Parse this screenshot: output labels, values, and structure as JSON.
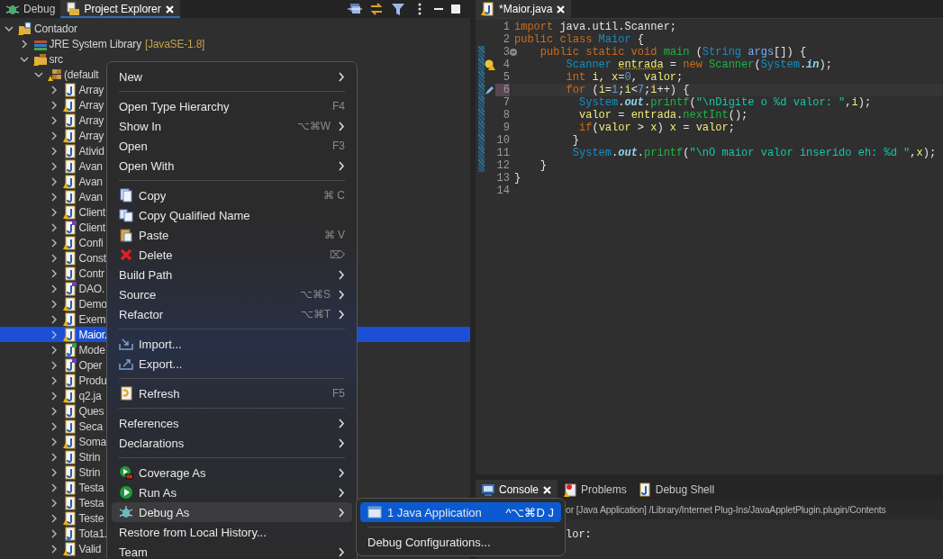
{
  "explorer": {
    "tabs": [
      {
        "label": "Debug",
        "kind": "debug",
        "selected": false,
        "closable": false
      },
      {
        "label": "Project Explorer",
        "kind": "explorer",
        "selected": true,
        "closable": true
      }
    ],
    "tree": [
      {
        "label": "Contador",
        "kind": "project",
        "expanded": true,
        "selected": false,
        "children": [
          {
            "label": "JRE System Library",
            "qualifier": "[JavaSE-1.8]",
            "kind": "library",
            "expanded": false,
            "selected": false
          },
          {
            "label": "src",
            "kind": "source-folder",
            "expanded": true,
            "selected": false,
            "children": [
              {
                "label": "(default",
                "kind": "package",
                "expanded": true,
                "selected": false,
                "children": [
                  {
                    "label": "Array",
                    "kind": "java",
                    "warning": false,
                    "expanded": false,
                    "selected": false
                  },
                  {
                    "label": "Array",
                    "kind": "java",
                    "warning": true,
                    "expanded": false,
                    "selected": false
                  },
                  {
                    "label": "Array",
                    "kind": "java",
                    "warning": false,
                    "expanded": false,
                    "selected": false
                  },
                  {
                    "label": "Array",
                    "kind": "java",
                    "warning": true,
                    "expanded": false,
                    "selected": false
                  },
                  {
                    "label": "Ativid",
                    "kind": "java",
                    "warning": false,
                    "expanded": false,
                    "selected": false
                  },
                  {
                    "label": "Avan",
                    "kind": "java",
                    "warning": false,
                    "expanded": false,
                    "selected": false
                  },
                  {
                    "label": "Avan",
                    "kind": "java",
                    "warning": true,
                    "expanded": false,
                    "selected": false
                  },
                  {
                    "label": "Avan",
                    "kind": "java",
                    "warning": false,
                    "expanded": false,
                    "selected": false
                  },
                  {
                    "label": "Client",
                    "kind": "java",
                    "warning": true,
                    "expanded": false,
                    "selected": false
                  },
                  {
                    "label": "Client",
                    "kind": "java-interface",
                    "warning": false,
                    "expanded": false,
                    "selected": false
                  },
                  {
                    "label": "Confi",
                    "kind": "java",
                    "warning": true,
                    "expanded": false,
                    "selected": false
                  },
                  {
                    "label": "Const",
                    "kind": "java",
                    "warning": false,
                    "expanded": false,
                    "selected": false
                  },
                  {
                    "label": "Contr",
                    "kind": "java",
                    "warning": false,
                    "expanded": false,
                    "selected": false
                  },
                  {
                    "label": "DAO.",
                    "kind": "java-interface",
                    "warning": false,
                    "expanded": false,
                    "selected": false
                  },
                  {
                    "label": "Demo",
                    "kind": "java",
                    "warning": true,
                    "expanded": false,
                    "selected": false
                  },
                  {
                    "label": "Exem",
                    "kind": "java",
                    "warning": true,
                    "expanded": false,
                    "selected": false
                  },
                  {
                    "label": "Maior.",
                    "kind": "java",
                    "warning": true,
                    "expanded": false,
                    "selected": true
                  },
                  {
                    "label": "Mode",
                    "kind": "java-abstract",
                    "warning": false,
                    "expanded": false,
                    "selected": false
                  },
                  {
                    "label": "Oper",
                    "kind": "java-interface",
                    "warning": false,
                    "expanded": false,
                    "selected": false
                  },
                  {
                    "label": "Produ",
                    "kind": "java",
                    "warning": false,
                    "expanded": false,
                    "selected": false
                  },
                  {
                    "label": "q2.ja",
                    "kind": "java",
                    "warning": true,
                    "expanded": false,
                    "selected": false
                  },
                  {
                    "label": "Ques",
                    "kind": "java",
                    "warning": false,
                    "expanded": false,
                    "selected": false
                  },
                  {
                    "label": "Seca",
                    "kind": "java",
                    "warning": false,
                    "expanded": false,
                    "selected": false
                  },
                  {
                    "label": "Soma",
                    "kind": "java",
                    "warning": true,
                    "expanded": false,
                    "selected": false
                  },
                  {
                    "label": "Strin",
                    "kind": "java",
                    "warning": false,
                    "expanded": false,
                    "selected": false
                  },
                  {
                    "label": "Strin",
                    "kind": "java",
                    "warning": false,
                    "expanded": false,
                    "selected": false
                  },
                  {
                    "label": "Testa",
                    "kind": "java",
                    "warning": false,
                    "expanded": false,
                    "selected": false
                  },
                  {
                    "label": "Testa",
                    "kind": "java",
                    "warning": false,
                    "expanded": false,
                    "selected": false
                  },
                  {
                    "label": "Teste",
                    "kind": "java",
                    "warning": true,
                    "expanded": false,
                    "selected": false
                  },
                  {
                    "label": "Tota1.",
                    "kind": "java-shared",
                    "warning": false,
                    "expanded": false,
                    "selected": false
                  },
                  {
                    "label": "Valid",
                    "kind": "java",
                    "warning": true,
                    "expanded": false,
                    "selected": false
                  }
                ]
              }
            ]
          }
        ]
      }
    ]
  },
  "context_menu": {
    "items": [
      {
        "kind": "plain",
        "label": "New",
        "submenu": true,
        "selected": false
      },
      {
        "kind": "separator"
      },
      {
        "kind": "plain",
        "label": "Open Type Hierarchy",
        "shortcut": "F4",
        "submenu": false,
        "selected": false
      },
      {
        "kind": "plain",
        "label": "Show In",
        "shortcut": "⌥⌘W",
        "submenu": true,
        "selected": false
      },
      {
        "kind": "plain",
        "label": "Open",
        "shortcut": "F3",
        "submenu": false,
        "selected": false
      },
      {
        "kind": "plain",
        "label": "Open With",
        "submenu": true,
        "selected": false
      },
      {
        "kind": "separator"
      },
      {
        "kind": "copy",
        "label": "Copy",
        "shortcut": "⌘ C",
        "submenu": false,
        "selected": false
      },
      {
        "kind": "copy-qualified",
        "label": "Copy Qualified Name",
        "submenu": false,
        "selected": false
      },
      {
        "kind": "paste",
        "label": "Paste",
        "shortcut": "⌘ V",
        "submenu": false,
        "selected": false
      },
      {
        "kind": "delete",
        "label": "Delete",
        "shortcut": "⌦",
        "submenu": false,
        "selected": false
      },
      {
        "kind": "plain",
        "label": "Build Path",
        "submenu": true,
        "selected": false
      },
      {
        "kind": "plain",
        "label": "Source",
        "shortcut": "⌥⌘S",
        "submenu": true,
        "selected": false
      },
      {
        "kind": "plain",
        "label": "Refactor",
        "shortcut": "⌥⌘T",
        "submenu": true,
        "selected": false
      },
      {
        "kind": "separator"
      },
      {
        "kind": "import",
        "label": "Import...",
        "submenu": false,
        "selected": false
      },
      {
        "kind": "export",
        "label": "Export...",
        "submenu": false,
        "selected": false
      },
      {
        "kind": "separator"
      },
      {
        "kind": "refresh",
        "label": "Refresh",
        "shortcut": "F5",
        "submenu": false,
        "selected": false
      },
      {
        "kind": "separator"
      },
      {
        "kind": "plain",
        "label": "References",
        "submenu": true,
        "selected": false
      },
      {
        "kind": "plain",
        "label": "Declarations",
        "submenu": true,
        "selected": false
      },
      {
        "kind": "separator"
      },
      {
        "kind": "coverage",
        "label": "Coverage As",
        "submenu": true,
        "selected": false
      },
      {
        "kind": "run",
        "label": "Run As",
        "submenu": true,
        "selected": false
      },
      {
        "kind": "debug",
        "label": "Debug As",
        "submenu": true,
        "selected": true
      },
      {
        "kind": "plain",
        "label": "Restore from Local History...",
        "submenu": false,
        "selected": false
      },
      {
        "kind": "plain",
        "label": "Team",
        "submenu": true,
        "selected": false
      }
    ]
  },
  "submenu": {
    "items": [
      {
        "kind": "java-app",
        "label": "1 Java Application",
        "shortcut": "^⌥⌘D J",
        "selected": true
      },
      {
        "kind": "separator"
      },
      {
        "kind": "plain",
        "label": "Debug Configurations...",
        "selected": false
      }
    ]
  },
  "editor": {
    "tab": {
      "label": "*Maior.java",
      "selected": true,
      "closable": true
    },
    "lines": [
      {
        "number": "1",
        "kind": "plain",
        "changed": false,
        "current": false,
        "tokens": [
          {
            "kind": "kw",
            "t": "import"
          },
          {
            "kind": "plain",
            "t": " java.util.Scanner;"
          }
        ]
      },
      {
        "number": "2",
        "kind": "plain",
        "changed": false,
        "current": false,
        "tokens": [
          {
            "kind": "kw",
            "t": "public class"
          },
          {
            "kind": "cls",
            "t": " Maior"
          },
          {
            "kind": "plain",
            "t": " {"
          }
        ]
      },
      {
        "number": "3",
        "kind": "fold",
        "changed": true,
        "current": false,
        "tokens": [
          {
            "kind": "kw",
            "t": "    public static void"
          },
          {
            "kind": "method",
            "t": " main"
          },
          {
            "kind": "plain",
            "t": " ("
          },
          {
            "kind": "type",
            "t": "String"
          },
          {
            "kind": "param",
            "t": " args"
          },
          {
            "kind": "plain",
            "t": "[]) {"
          }
        ]
      },
      {
        "number": "4",
        "kind": "warning",
        "changed": true,
        "current": false,
        "tokens": [
          {
            "kind": "type",
            "t": "        Scanner "
          },
          {
            "kind": "warnvar",
            "t": "entrada"
          },
          {
            "kind": "plain",
            "t": " = "
          },
          {
            "kind": "kw",
            "t": "new"
          },
          {
            "kind": "method",
            "t": " Scanner"
          },
          {
            "kind": "plain",
            "t": "("
          },
          {
            "kind": "type",
            "t": "System"
          },
          {
            "kind": "plain",
            "t": "."
          },
          {
            "kind": "field",
            "t": "in"
          },
          {
            "kind": "plain",
            "t": ");"
          }
        ]
      },
      {
        "number": "5",
        "kind": "plain",
        "changed": true,
        "current": false,
        "tokens": [
          {
            "kind": "kw",
            "t": "        int"
          },
          {
            "kind": "var",
            "t": " i"
          },
          {
            "kind": "plain",
            "t": ", "
          },
          {
            "kind": "var",
            "t": "x"
          },
          {
            "kind": "plain",
            "t": "="
          },
          {
            "kind": "num",
            "t": "0"
          },
          {
            "kind": "plain",
            "t": ", "
          },
          {
            "kind": "var",
            "t": "valor"
          },
          {
            "kind": "plain",
            "t": ";"
          }
        ]
      },
      {
        "number": "6",
        "kind": "bookmark",
        "changed": true,
        "current": true,
        "tokens": [
          {
            "kind": "kw",
            "t": "        for"
          },
          {
            "kind": "plain",
            "t": " ("
          },
          {
            "kind": "var",
            "t": "i"
          },
          {
            "kind": "plain",
            "t": "="
          },
          {
            "kind": "num",
            "t": "1"
          },
          {
            "kind": "plain",
            "t": ";"
          },
          {
            "kind": "var",
            "t": "i"
          },
          {
            "kind": "plain",
            "t": "<"
          },
          {
            "kind": "num",
            "t": "7"
          },
          {
            "kind": "plain",
            "t": ";"
          },
          {
            "kind": "var",
            "t": "i"
          },
          {
            "kind": "plain",
            "t": "++) {"
          }
        ]
      },
      {
        "number": "7",
        "kind": "plain",
        "changed": true,
        "current": false,
        "tokens": [
          {
            "kind": "type",
            "t": "          System"
          },
          {
            "kind": "plain",
            "t": "."
          },
          {
            "kind": "field",
            "t": "out"
          },
          {
            "kind": "plain",
            "t": "."
          },
          {
            "kind": "method",
            "t": "printf"
          },
          {
            "kind": "plain",
            "t": "("
          },
          {
            "kind": "str",
            "t": "\"\\nDigite o %d valor: \""
          },
          {
            "kind": "plain",
            "t": ","
          },
          {
            "kind": "var",
            "t": "i"
          },
          {
            "kind": "plain",
            "t": ");"
          }
        ]
      },
      {
        "number": "8",
        "kind": "plain",
        "changed": true,
        "current": false,
        "tokens": [
          {
            "kind": "var",
            "t": "          valor"
          },
          {
            "kind": "plain",
            "t": " = "
          },
          {
            "kind": "var",
            "t": "entrada"
          },
          {
            "kind": "plain",
            "t": "."
          },
          {
            "kind": "method",
            "t": "nextInt"
          },
          {
            "kind": "plain",
            "t": "();"
          }
        ]
      },
      {
        "number": "9",
        "kind": "plain",
        "changed": true,
        "current": false,
        "tokens": [
          {
            "kind": "kw",
            "t": "          if"
          },
          {
            "kind": "plain",
            "t": "("
          },
          {
            "kind": "var",
            "t": "valor"
          },
          {
            "kind": "plain",
            "t": " > "
          },
          {
            "kind": "var",
            "t": "x"
          },
          {
            "kind": "plain",
            "t": ") "
          },
          {
            "kind": "var",
            "t": "x"
          },
          {
            "kind": "plain",
            "t": " = "
          },
          {
            "kind": "var",
            "t": "valor"
          },
          {
            "kind": "plain",
            "t": ";"
          }
        ]
      },
      {
        "number": "10",
        "kind": "plain",
        "changed": true,
        "current": false,
        "tokens": [
          {
            "kind": "plain",
            "t": "         }"
          }
        ]
      },
      {
        "number": "11",
        "kind": "plain",
        "changed": true,
        "current": false,
        "tokens": [
          {
            "kind": "type",
            "t": "         System"
          },
          {
            "kind": "plain",
            "t": "."
          },
          {
            "kind": "field",
            "t": "out"
          },
          {
            "kind": "plain",
            "t": "."
          },
          {
            "kind": "method",
            "t": "printf"
          },
          {
            "kind": "plain",
            "t": "("
          },
          {
            "kind": "str",
            "t": "\"\\nO maior valor inserido eh: %d \""
          },
          {
            "kind": "plain",
            "t": ","
          },
          {
            "kind": "var",
            "t": "x"
          },
          {
            "kind": "plain",
            "t": ");"
          }
        ]
      },
      {
        "number": "12",
        "kind": "plain",
        "changed": true,
        "current": false,
        "tokens": [
          {
            "kind": "plain",
            "t": "    }"
          }
        ]
      },
      {
        "number": "13",
        "kind": "plain",
        "changed": false,
        "current": false,
        "tokens": [
          {
            "kind": "plain",
            "t": "}"
          }
        ]
      },
      {
        "number": "14",
        "kind": "plain",
        "changed": false,
        "current": false
      }
    ]
  },
  "console": {
    "tabs": [
      {
        "label": "Console",
        "kind": "console",
        "selected": true,
        "closable": true
      },
      {
        "label": "Problems",
        "kind": "problems",
        "selected": false,
        "closable": false
      },
      {
        "label": "Debug Shell",
        "kind": "shell",
        "selected": false,
        "closable": false
      }
    ],
    "description": "or [Java Application] /Library/Internet Plug-Ins/JavaAppletPlugin.plugin/Contents",
    "output": "lor:"
  }
}
